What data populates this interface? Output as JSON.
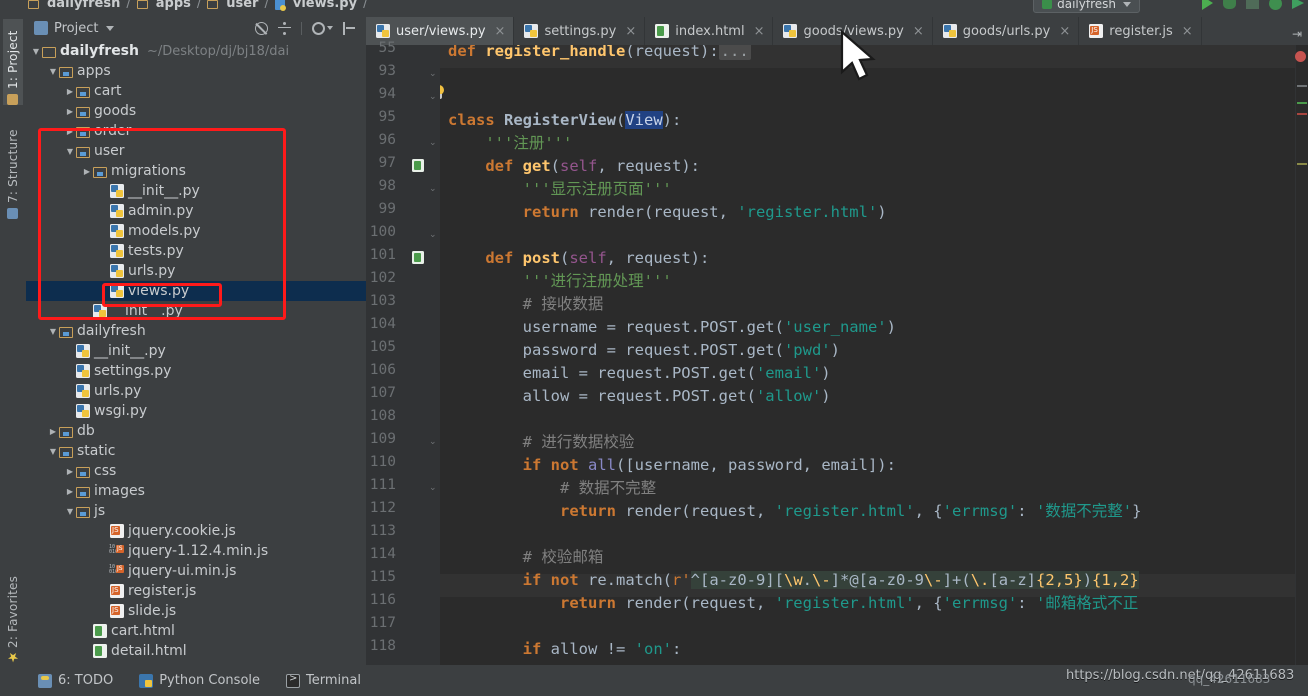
{
  "window": {
    "breadcrumb": [
      "dailyfresh",
      "apps",
      "user",
      "views.py"
    ],
    "run_config": "dailyfresh"
  },
  "left_tool_strip": {
    "tabs": [
      {
        "label": "1: Project",
        "icon": "project-icon",
        "selected": true
      },
      {
        "label": "7: Structure",
        "icon": "structure-icon",
        "selected": false
      },
      {
        "label": "2: Favorites",
        "icon": "star-icon",
        "selected": false
      }
    ]
  },
  "project_panel": {
    "title": "Project",
    "tools": [
      "collapse-all-icon",
      "expand-all-icon",
      "settings-gear-icon",
      "hide-panel-icon"
    ],
    "tree": [
      {
        "label": "dailyfresh",
        "path": "~/Desktop/dj/bj18/dai",
        "icon": "folder-icon",
        "indent": 0,
        "arrow": "down",
        "root": true
      },
      {
        "label": "apps",
        "icon": "module-folder-icon",
        "indent": 1,
        "arrow": "down"
      },
      {
        "label": "cart",
        "icon": "module-folder-icon",
        "indent": 2,
        "arrow": "right"
      },
      {
        "label": "goods",
        "icon": "module-folder-icon",
        "indent": 2,
        "arrow": "right"
      },
      {
        "label": "order",
        "icon": "module-folder-icon",
        "indent": 2,
        "arrow": "right"
      },
      {
        "label": "user",
        "icon": "module-folder-icon",
        "indent": 2,
        "arrow": "down"
      },
      {
        "label": "migrations",
        "icon": "module-folder-icon",
        "indent": 3,
        "arrow": "right"
      },
      {
        "label": "__init__.py",
        "icon": "python-file-icon",
        "indent": 4,
        "arrow": ""
      },
      {
        "label": "admin.py",
        "icon": "python-file-icon",
        "indent": 4,
        "arrow": ""
      },
      {
        "label": "models.py",
        "icon": "python-file-icon",
        "indent": 4,
        "arrow": ""
      },
      {
        "label": "tests.py",
        "icon": "python-file-icon",
        "indent": 4,
        "arrow": ""
      },
      {
        "label": "urls.py",
        "icon": "python-file-icon",
        "indent": 4,
        "arrow": ""
      },
      {
        "label": "views.py",
        "icon": "python-file-icon",
        "indent": 4,
        "arrow": "",
        "selected": true
      },
      {
        "label": "__init__.py",
        "icon": "python-file-icon",
        "indent": 3,
        "arrow": ""
      },
      {
        "label": "dailyfresh",
        "icon": "module-folder-icon",
        "indent": 1,
        "arrow": "down"
      },
      {
        "label": "__init__.py",
        "icon": "python-file-icon",
        "indent": 2,
        "arrow": ""
      },
      {
        "label": "settings.py",
        "icon": "python-file-icon",
        "indent": 2,
        "arrow": ""
      },
      {
        "label": "urls.py",
        "icon": "python-file-icon",
        "indent": 2,
        "arrow": ""
      },
      {
        "label": "wsgi.py",
        "icon": "python-file-icon",
        "indent": 2,
        "arrow": ""
      },
      {
        "label": "db",
        "icon": "module-folder-icon",
        "indent": 1,
        "arrow": "right"
      },
      {
        "label": "static",
        "icon": "module-folder-icon",
        "indent": 1,
        "arrow": "down"
      },
      {
        "label": "css",
        "icon": "module-folder-icon",
        "indent": 2,
        "arrow": "right"
      },
      {
        "label": "images",
        "icon": "module-folder-icon",
        "indent": 2,
        "arrow": "right"
      },
      {
        "label": "js",
        "icon": "module-folder-icon",
        "indent": 2,
        "arrow": "down"
      },
      {
        "label": "jquery.cookie.js",
        "icon": "js-file-icon",
        "indent": 4,
        "arrow": ""
      },
      {
        "label": "jquery-1.12.4.min.js",
        "icon": "js-min-file-icon",
        "indent": 4,
        "arrow": ""
      },
      {
        "label": "jquery-ui.min.js",
        "icon": "js-min-file-icon",
        "indent": 4,
        "arrow": ""
      },
      {
        "label": "register.js",
        "icon": "js-file-icon",
        "indent": 4,
        "arrow": ""
      },
      {
        "label": "slide.js",
        "icon": "js-file-icon",
        "indent": 4,
        "arrow": ""
      },
      {
        "label": "cart.html",
        "icon": "html-file-icon",
        "indent": 3,
        "arrow": ""
      },
      {
        "label": "detail.html",
        "icon": "html-file-icon",
        "indent": 3,
        "arrow": ""
      }
    ]
  },
  "editor": {
    "tabs": [
      {
        "label": "user/views.py",
        "icon": "python-file-icon",
        "active": true
      },
      {
        "label": "settings.py",
        "icon": "python-file-icon",
        "active": false
      },
      {
        "label": "index.html",
        "icon": "html-file-icon",
        "active": false
      },
      {
        "label": "goods/views.py",
        "icon": "python-file-icon",
        "active": false
      },
      {
        "label": "goods/urls.py",
        "icon": "python-file-icon",
        "active": false
      },
      {
        "label": "register.js",
        "icon": "js-file-icon",
        "active": false
      }
    ],
    "line_numbers": [
      55,
      93,
      94,
      95,
      96,
      97,
      98,
      99,
      100,
      101,
      102,
      103,
      104,
      105,
      106,
      107,
      108,
      109,
      110,
      111,
      112,
      113,
      114,
      115,
      116,
      117,
      118
    ],
    "gutter_run_marks": [
      97,
      101
    ],
    "code_lines": [
      {
        "n": 55,
        "text": "def register_handle(request):..."
      },
      {
        "n": 93,
        "text": ""
      },
      {
        "n": 94,
        "text": ""
      },
      {
        "n": 95,
        "text": "class RegisterView(View):"
      },
      {
        "n": 96,
        "text": "    '''注册'''"
      },
      {
        "n": 97,
        "text": "    def get(self, request):"
      },
      {
        "n": 98,
        "text": "        '''显示注册页面'''"
      },
      {
        "n": 99,
        "text": "        return render(request, 'register.html')"
      },
      {
        "n": 100,
        "text": ""
      },
      {
        "n": 101,
        "text": "    def post(self, request):"
      },
      {
        "n": 102,
        "text": "        '''进行注册处理'''"
      },
      {
        "n": 103,
        "text": "        # 接收数据"
      },
      {
        "n": 104,
        "text": "        username = request.POST.get('user_name')"
      },
      {
        "n": 105,
        "text": "        password = request.POST.get('pwd')"
      },
      {
        "n": 106,
        "text": "        email = request.POST.get('email')"
      },
      {
        "n": 107,
        "text": "        allow = request.POST.get('allow')"
      },
      {
        "n": 108,
        "text": ""
      },
      {
        "n": 109,
        "text": "        # 进行数据校验"
      },
      {
        "n": 110,
        "text": "        if not all([username, password, email]):"
      },
      {
        "n": 111,
        "text": "            # 数据不完整"
      },
      {
        "n": 112,
        "text": "            return render(request, 'register.html', {'errmsg': '数据不完整'})"
      },
      {
        "n": 113,
        "text": ""
      },
      {
        "n": 114,
        "text": "        # 校验邮箱"
      },
      {
        "n": 115,
        "text": "        if not re.match(r'^[a-z0-9][\\w.\\-]*@[a-z0-9\\-]+(\\.[a-z]{2,5}){1,2}"
      },
      {
        "n": 116,
        "text": "            return render(request, 'register.html', {'errmsg': '邮箱格式不正"
      },
      {
        "n": 117,
        "text": ""
      },
      {
        "n": 118,
        "text": "        if allow != 'on':"
      }
    ],
    "selected_token": "View",
    "colors": {
      "background": "#2b2b2b",
      "gutter": "#313335",
      "keyword": "#cc7832",
      "string": "#6a8759",
      "docstring": "#629755",
      "comment": "#808080",
      "function": "#ffc66d",
      "self": "#94558d",
      "text": "#a9b7c6",
      "selection": "#214283",
      "annotation_red": "#ff1a1a"
    }
  },
  "status_bar": {
    "items": [
      {
        "label": "6: TODO",
        "icon": "todo-icon",
        "shortcut": "6"
      },
      {
        "label": "Python Console",
        "icon": "python-console-icon"
      },
      {
        "label": "Terminal",
        "icon": "terminal-icon"
      }
    ]
  },
  "watermark": {
    "url": "https://blog.csdn.net/qq_42611683",
    "secondary": "qq_42611683"
  }
}
